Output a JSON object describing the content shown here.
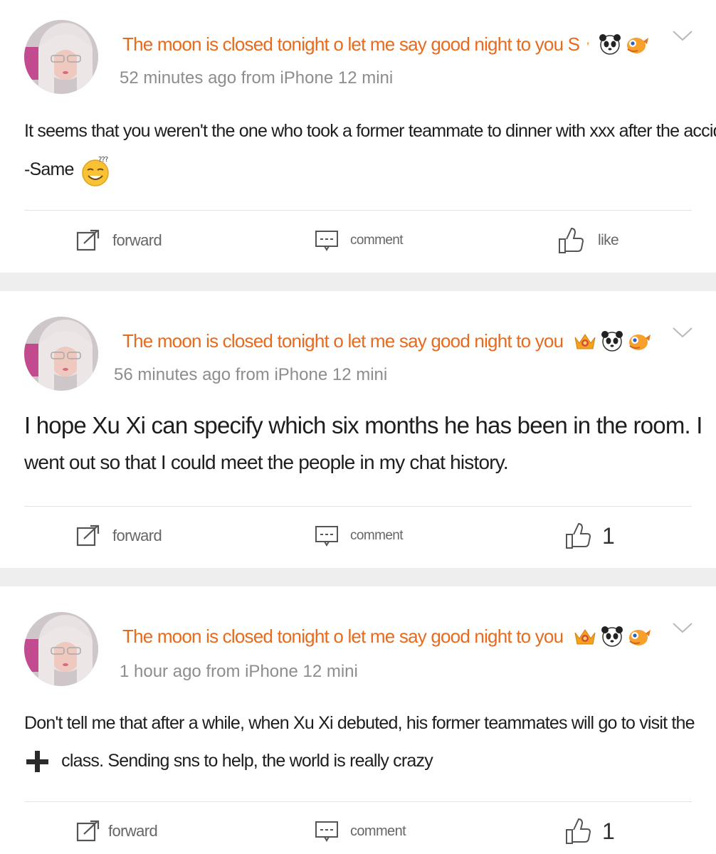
{
  "posts": [
    {
      "username": "The moon is closed tonight o let me say good night to you S",
      "meta": "52 minutes ago from iPhone 12 mini",
      "content_line1": "It seems that you weren't the one who took a former teammate to dinner with xxx after the accident.",
      "content_line2": "-Same",
      "forward": "forward",
      "comment": "comment",
      "like": "like",
      "like_count": ""
    },
    {
      "username": "The moon is closed tonight o let me say good night to you",
      "meta": "56 minutes ago from iPhone 12 mini",
      "content_line1": "I hope Xu Xi can specify which six months he has been in the room. I",
      "content_line2": "went out so that I could meet the people in my chat history.",
      "forward": "forward",
      "comment": "comment",
      "like": "",
      "like_count": "1"
    },
    {
      "username": "The moon is closed tonight o let me say good night to you",
      "meta": "1 hour ago from iPhone 12 mini",
      "content_line1": "Don't tell me that after a while, when Xu Xi debuted, his former teammates will go to visit the",
      "content_line2": "class. Sending sns to help, the world is really crazy",
      "forward": "forward",
      "comment": "comment",
      "like": "",
      "like_count": "1"
    }
  ],
  "colors": {
    "username": "#e86a1d",
    "meta": "#8d8d8d",
    "separator": "#eeeeee"
  },
  "icons": [
    "avatar",
    "crown-badge-icon",
    "panda-badge-icon",
    "orange-bird-badge-icon",
    "chevron-down-icon",
    "forward-icon",
    "comment-icon",
    "like-icon",
    "smile-emoji-icon",
    "plus-icon"
  ]
}
